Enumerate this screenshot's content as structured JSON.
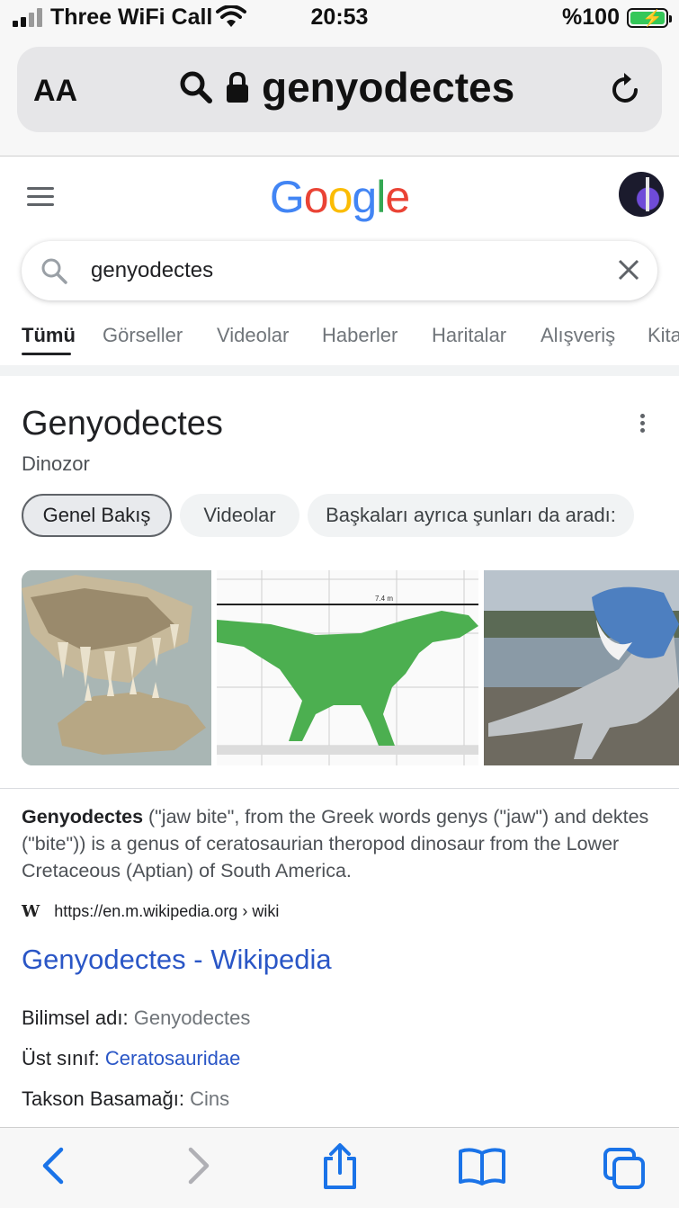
{
  "status_bar": {
    "carrier": "Three WiFi Call",
    "time": "20:53",
    "battery": "%100"
  },
  "address_bar": {
    "text_size_label": "AA",
    "url": "genyodectes"
  },
  "search": {
    "query": "genyodectes"
  },
  "tabs": [
    {
      "label": "Tümü",
      "active": true
    },
    {
      "label": "Görseller"
    },
    {
      "label": "Videolar"
    },
    {
      "label": "Haberler"
    },
    {
      "label": "Haritalar"
    },
    {
      "label": "Alışveriş"
    },
    {
      "label": "Kitaplar"
    }
  ],
  "knowledge_panel": {
    "title": "Genyodectes",
    "subtitle": "Dinozor",
    "chips": [
      "Genel Bakış",
      "Videolar",
      "Başkaları ayrıca şunları da aradı:"
    ],
    "scale_label": "7.4 m",
    "description_bold": "Genyodectes",
    "description_rest": " (\"jaw bite\", from the Greek words genys (\"jaw\") and dektes (\"bite\")) is a genus of ceratosaurian theropod dinosaur from the Lower Cretaceous (Aptian) of South America.",
    "source_url": "https://en.m.wikipedia.org › wiki",
    "source_icon": "W",
    "link_title": "Genyodectes - Wikipedia",
    "facts": [
      {
        "label": "Bilimsel adı:",
        "value": "Genyodectes"
      },
      {
        "label": "Üst sınıf:",
        "value": "Ceratosauridae"
      },
      {
        "label": "Takson Basamağı:",
        "value": "Cins"
      }
    ]
  },
  "colors": {
    "link": "#2a56c6",
    "google_blue": "#4285f4",
    "google_red": "#ea4335",
    "google_yellow": "#fbbc05",
    "google_green": "#34a853",
    "safari_blue": "#1a73e8"
  }
}
